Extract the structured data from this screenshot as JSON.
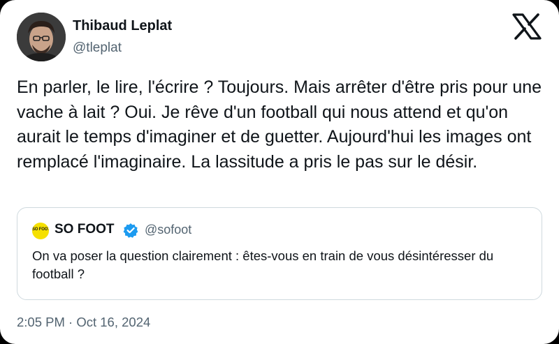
{
  "author": {
    "name": "Thibaud Leplat",
    "handle": "@tleplat"
  },
  "platform_icon": "x-logo-icon",
  "tweet": {
    "text": "En parler, le lire, l'écrire ? Toujours. Mais arrêter d'être pris pour une vache à lait ? Oui. Je rêve d'un football qui nous attend et qu'on aurait le temps d'imaginer et de guetter. Aujourd'hui les images ont remplacé l'imaginaire. La lassitude a pris le pas sur le désir.",
    "timestamp": "2:05 PM · Oct 16, 2024"
  },
  "quoted_tweet": {
    "avatar_text": "SO FOOT",
    "name": "SO FOOT",
    "verified": true,
    "handle": "@sofoot",
    "text": "On va poser la question clairement : êtes-vous en train de vous désintéresser du football ?"
  },
  "colors": {
    "text_primary": "#0f1419",
    "text_secondary": "#536471",
    "verified_blue": "#1d9bf0",
    "border": "#cfd9de",
    "sofoot_yellow": "#f5e000"
  }
}
